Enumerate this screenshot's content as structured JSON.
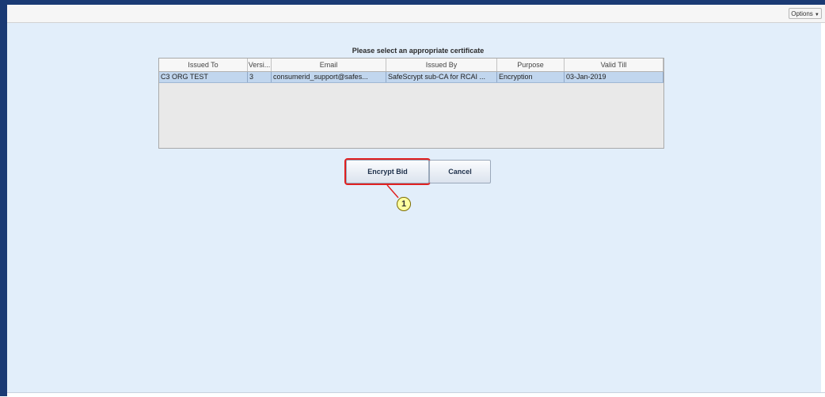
{
  "toolbar": {
    "options_label": "Options"
  },
  "dialog": {
    "prompt": "Please select an appropriate certificate",
    "columns": [
      "Issued To",
      "Versi...",
      "Email",
      "Issued By",
      "Purpose",
      "Valid Till"
    ],
    "rows": [
      {
        "issued_to": "C3 ORG TEST",
        "version": "3",
        "email": "consumerid_support@safes...",
        "issued_by": "SafeScrypt sub-CA for RCAI ...",
        "purpose": "Encryption",
        "valid_till": "03-Jan-2019"
      }
    ],
    "encrypt_label": "Encrypt Bid",
    "cancel_label": "Cancel"
  },
  "annotation": {
    "step_number": "1"
  },
  "colors": {
    "header_bar": "#1a3a74",
    "background": "#e2eefa",
    "selected_row": "#c1d6ee",
    "highlight": "#e02020",
    "callout_fill": "#ffffa0"
  }
}
